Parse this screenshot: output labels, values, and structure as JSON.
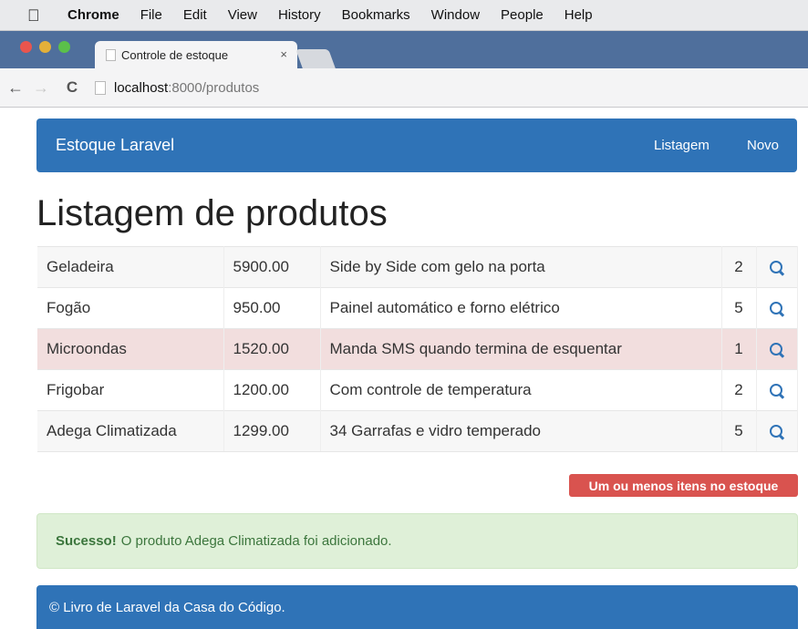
{
  "menubar": {
    "apple_icon": "apple-icon",
    "items": [
      "Chrome",
      "File",
      "Edit",
      "View",
      "History",
      "Bookmarks",
      "Window",
      "People",
      "Help"
    ]
  },
  "browser": {
    "tab_title": "Controle de estoque",
    "tab_close": "×",
    "url_host": "localhost",
    "url_path": ":8000/produtos"
  },
  "navbar": {
    "brand": "Estoque Laravel",
    "links": [
      "Listagem",
      "Novo"
    ]
  },
  "page_title": "Listagem de produtos",
  "products": [
    {
      "name": "Geladeira",
      "price": "5900.00",
      "description": "Side by Side com gelo na porta",
      "qty": "2",
      "status": "normal"
    },
    {
      "name": "Fogão",
      "price": "950.00",
      "description": "Painel automático e forno elétrico",
      "qty": "5",
      "status": "normal"
    },
    {
      "name": "Microondas",
      "price": "1520.00",
      "description": "Manda SMS quando termina de esquentar",
      "qty": "1",
      "status": "danger"
    },
    {
      "name": "Frigobar",
      "price": "1200.00",
      "description": "Com controle de temperatura",
      "qty": "2",
      "status": "normal"
    },
    {
      "name": "Adega Climatizada",
      "price": "1299.00",
      "description": "34 Garrafas e vidro temperado",
      "qty": "5",
      "status": "normal"
    }
  ],
  "row_action_icon": "search-icon",
  "legend_label": "Um ou menos itens no estoque",
  "alert": {
    "strong": "Sucesso!",
    "message": "O produto Adega Climatizada foi adicionado."
  },
  "footer": "© Livro de Laravel da Casa do Código.",
  "colors": {
    "primary": "#2f73b7",
    "danger": "#d9534f",
    "danger_row": "#f2dede",
    "success_bg": "#dff0d8",
    "success_text": "#3c763d"
  }
}
